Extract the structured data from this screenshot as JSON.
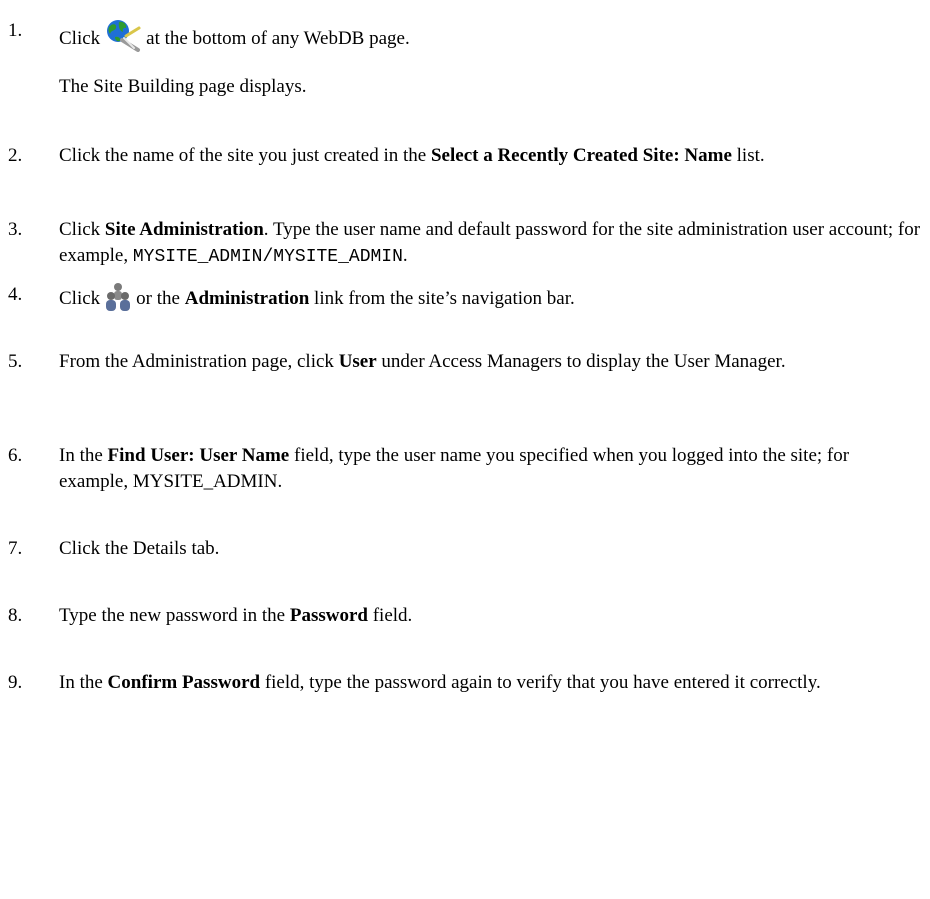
{
  "steps": [
    {
      "num": "1.",
      "pre": "Click",
      "icon": "site-building-globe-icon",
      "post": "at the bottom of any WebDB page.",
      "sub": "The Site Building page displays."
    },
    {
      "num": "2.",
      "t1": "Click the name of the site you just created in the ",
      "b1": "Select a Recently Created Site: Name",
      "t2": " list."
    },
    {
      "num": "3.",
      "t0": "Click ",
      "b1": "Site Administration",
      "t1": ".  Type the user name and default password for the site administration user account; for example, ",
      "mono": "MYSITE_ADMIN/MYSITE_ADMIN",
      "t2": "."
    },
    {
      "num": "4.",
      "pre": "Click",
      "icon": "users-administration-icon",
      "t1": "or the ",
      "b1": "Administration",
      "t2": " link from the site’s navigation bar."
    },
    {
      "num": "5.",
      "t0": "From the Administration page, click ",
      "b1": "User",
      "t1": " under Access Managers to display the User Manager."
    },
    {
      "num": "6.",
      "t0": "In the ",
      "b1": "Find User: User Name",
      "t1": " field, type the user name you specified when you logged into the site; for example, MYSITE_ADMIN."
    },
    {
      "num": "7.",
      "t0": "Click the Details tab."
    },
    {
      "num": "8.",
      "t0": "Type the new password in the ",
      "b1": "Password",
      "t1": " field."
    },
    {
      "num": "9.",
      "t0": "In the ",
      "b1": "Confirm Password",
      "t1": " field, type the password again to verify that you have entered it correctly."
    }
  ],
  "colors": {
    "text": "#000000",
    "background": "#ffffff"
  }
}
